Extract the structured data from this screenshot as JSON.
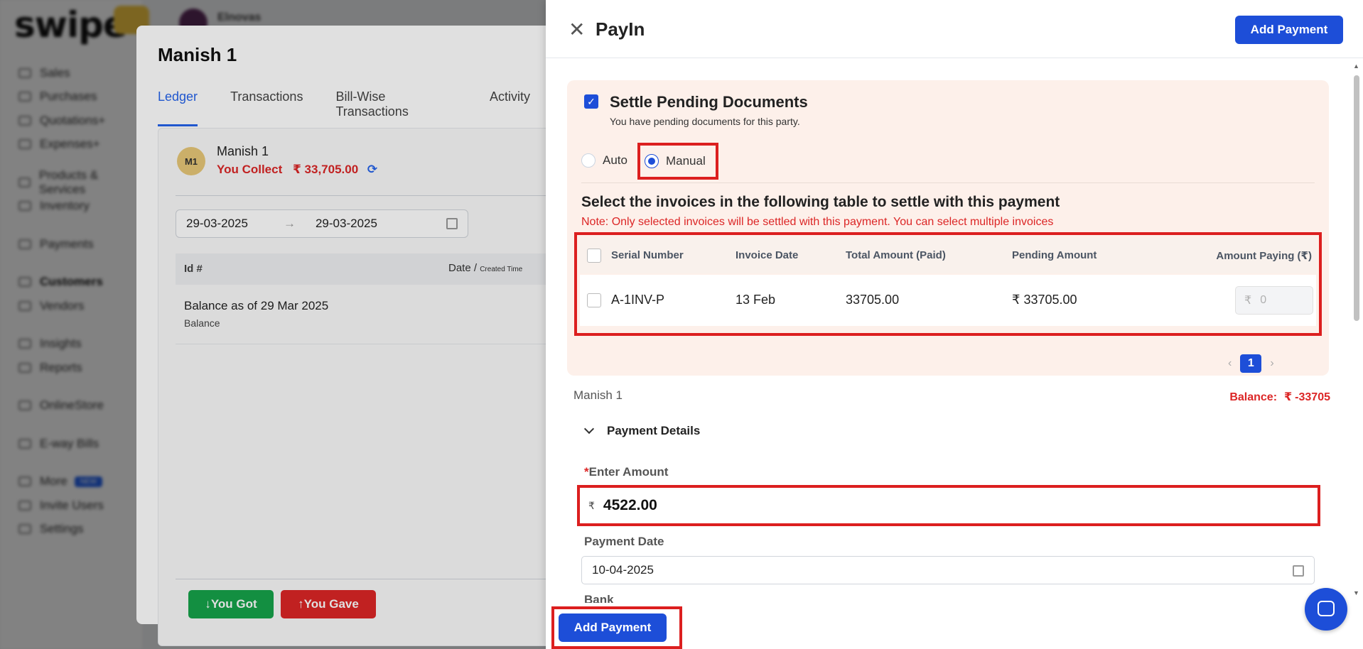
{
  "background": {
    "logo": "swipe",
    "brand": "Elnovas",
    "nav_items": [
      {
        "label": "Sales"
      },
      {
        "label": "Purchases"
      },
      {
        "label": "Quotations+"
      },
      {
        "label": "Expenses+"
      },
      {
        "label": "Products & Services"
      },
      {
        "label": "Inventory"
      },
      {
        "label": "Payments"
      },
      {
        "label": "Customers"
      },
      {
        "label": "Vendors"
      },
      {
        "label": "Insights"
      },
      {
        "label": "Reports"
      },
      {
        "label": "OnlineStore"
      },
      {
        "label": "E-way Bills"
      },
      {
        "label": "More",
        "badge": "NEW"
      },
      {
        "label": "Invite Users"
      },
      {
        "label": "Settings"
      }
    ]
  },
  "party_modal": {
    "title": "Manish 1",
    "tabs": [
      "Ledger",
      "Transactions",
      "Bill-Wise Transactions",
      "Activity"
    ],
    "avatar_initials": "M1",
    "party_name": "Manish 1",
    "collect_label": "You Collect",
    "collect_amount": "₹ 33,705.00",
    "date_from": "29-03-2025",
    "date_to": "29-03-2025",
    "table_headers": {
      "id": "Id #",
      "date": "Date /",
      "date_small": "Created Time"
    },
    "balance_row": {
      "title": "Balance as of 29 Mar 2025",
      "subtitle": "Balance"
    },
    "btn_got": "You Got",
    "btn_gave": "You Gave"
  },
  "drawer": {
    "title": "PayIn",
    "add_payment_label": "Add Payment",
    "settle": {
      "title": "Settle Pending Documents",
      "subtitle": "You have pending documents for this party.",
      "radio_auto": "Auto",
      "radio_manual": "Manual",
      "selected_mode": "Manual",
      "heading": "Select the invoices in the following table to settle with this payment",
      "note": "Note: Only selected invoices will be settled with this payment. You can select multiple invoices"
    },
    "invoice_table": {
      "headers": [
        "Serial Number",
        "Invoice Date",
        "Total Amount (Paid)",
        "Pending Amount",
        "Amount Paying (₹)"
      ],
      "rows": [
        {
          "serial": "A-1INV-P",
          "date": "13 Feb",
          "total": "33705.00",
          "pending": "₹ 33705.00",
          "paying_currency": "₹",
          "paying_placeholder": "0"
        }
      ]
    },
    "pagination": {
      "current": "1"
    },
    "party_name": "Manish 1",
    "balance_label": "Balance:",
    "balance_currency": "₹",
    "balance_value": "-33705",
    "payment_details_label": "Payment Details",
    "amount_label": "Enter Amount",
    "amount_currency": "₹",
    "amount_value": "4522.00",
    "date_label": "Payment Date",
    "date_value": "10-04-2025",
    "bank_label": "Bank"
  },
  "colors": {
    "primary": "#1d4ed8",
    "danger": "#dc2626",
    "success": "#16a34a",
    "settle_bg": "#fdf0ea",
    "highlight": "#dc1f1f"
  }
}
